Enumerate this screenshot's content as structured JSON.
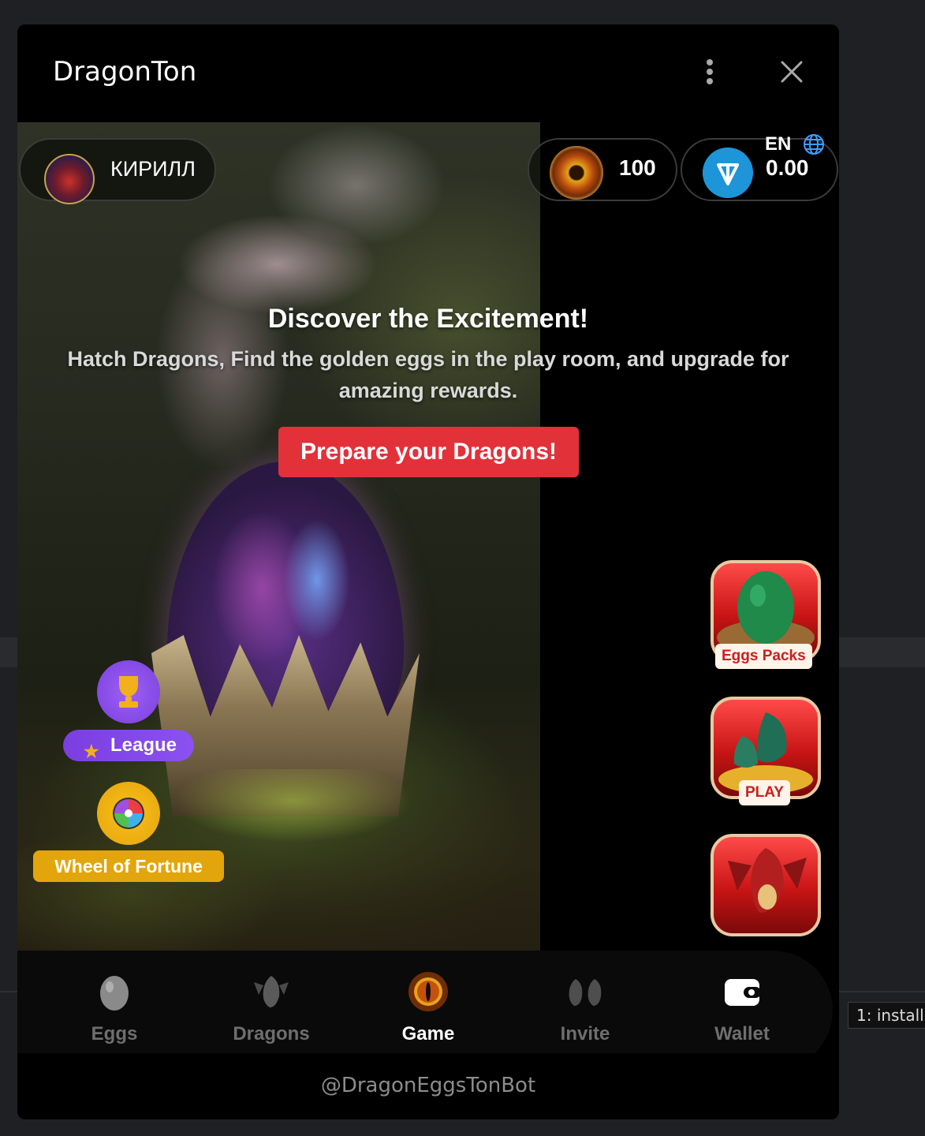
{
  "window": {
    "title": "DragonTon"
  },
  "user": {
    "name": "КИРИЛЛ"
  },
  "balances": {
    "coins": "100",
    "ton": "0.00"
  },
  "language": "EN",
  "hero": {
    "title": "Discover the Excitement!",
    "subtitle": "Hatch Dragons, Find the golden eggs in the play room, and upgrade for amazing rewards.",
    "cta": "Prepare your Dragons!"
  },
  "left_buttons": {
    "league": "League",
    "wheel": "Wheel of Fortune"
  },
  "right_tiles": {
    "eggs_packs": "Eggs Packs",
    "play": "PLAY"
  },
  "nav": {
    "items": [
      {
        "label": "Eggs",
        "icon": "egg-icon"
      },
      {
        "label": "Dragons",
        "icon": "dragon-icon"
      },
      {
        "label": "Game",
        "icon": "dragon-eye-icon"
      },
      {
        "label": "Invite",
        "icon": "dragons-pair-icon"
      },
      {
        "label": "Wallet",
        "icon": "wallet-icon"
      }
    ],
    "active": "Game"
  },
  "footer": {
    "bot_handle": "@DragonEggsTonBot"
  },
  "background": {
    "terminal_tab": "1: install"
  },
  "colors": {
    "accent_red": "#e3313a",
    "league_purple": "#7b3ee0",
    "wheel_gold": "#e3a50c",
    "ton_blue": "#1d95d8"
  }
}
